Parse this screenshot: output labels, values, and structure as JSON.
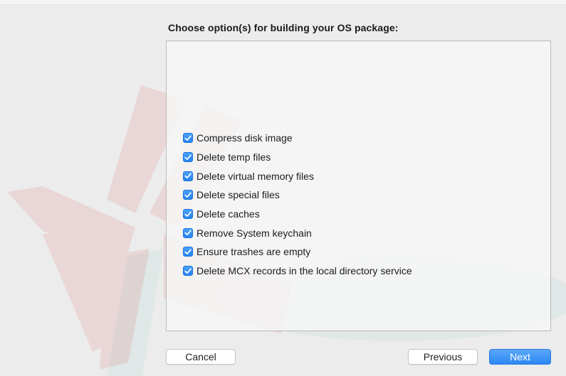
{
  "heading": "Choose option(s) for building your OS package:",
  "options": [
    {
      "label": "Compress disk image",
      "checked": true
    },
    {
      "label": "Delete temp files",
      "checked": true
    },
    {
      "label": "Delete virtual memory files",
      "checked": true
    },
    {
      "label": "Delete special files",
      "checked": true
    },
    {
      "label": "Delete caches",
      "checked": true
    },
    {
      "label": "Remove System keychain",
      "checked": true
    },
    {
      "label": "Ensure trashes are empty",
      "checked": true
    },
    {
      "label": "Delete MCX records in the local directory service",
      "checked": true
    }
  ],
  "buttons": {
    "cancel": "Cancel",
    "previous": "Previous",
    "next": "Next"
  },
  "colors": {
    "accent": "#2f8df5",
    "logo_red": "#d94a4a",
    "logo_teal": "#5bb8b0"
  },
  "icons": {
    "checkbox_checked": "checkmark-icon",
    "watermark": "app-logo-watermark"
  }
}
